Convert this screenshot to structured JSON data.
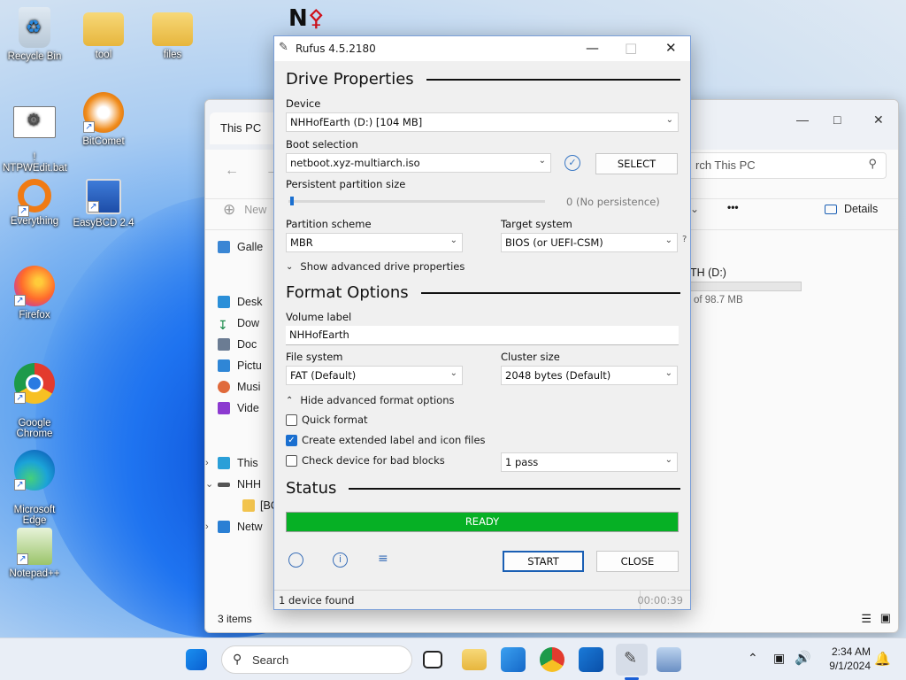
{
  "desktop": {
    "icons": [
      {
        "label": "Recycle Bin"
      },
      {
        "label": "tool"
      },
      {
        "label": "files"
      },
      {
        "label": "!\nNTPWEdit.bat"
      },
      {
        "label": "BitComet"
      },
      {
        "label": "Everything"
      },
      {
        "label": "EasyBCD 2.4"
      },
      {
        "label": "Firefox"
      },
      {
        "label": "Google\nChrome"
      },
      {
        "label": "Microsoft\nEdge"
      },
      {
        "label": "Notepad++"
      }
    ]
  },
  "explorer": {
    "tab": "This PC",
    "search_placeholder": "rch This PC",
    "new_label": "New",
    "details_label": "Details",
    "more": "•••",
    "nav": [
      "Galle",
      "Desk",
      "Dow",
      "Doc",
      "Pictu",
      "Musi",
      "Vide",
      "This",
      "NHH",
      "[BO",
      "Netw"
    ],
    "drive_label": "TH (D:)",
    "drive_free": "of 98.7 MB",
    "status": "3 items"
  },
  "rufus": {
    "title": "Rufus 4.5.2180",
    "drive_properties": "Drive Properties",
    "device_label": "Device",
    "device_value": "NHHofEarth (D:) [104 MB]",
    "boot_label": "Boot selection",
    "boot_value": "netboot.xyz-multiarch.iso",
    "select_button": "SELECT",
    "persistent_label": "Persistent partition size",
    "persistent_value": "0 (No persistence)",
    "partition_label": "Partition scheme",
    "partition_value": "MBR",
    "target_label": "Target system",
    "target_value": "BIOS (or UEFI-CSM)",
    "help_mark": "?",
    "show_advanced": "Show advanced drive properties",
    "format_options": "Format Options",
    "volume_label": "Volume label",
    "volume_value": "NHHofEarth",
    "filesystem_label": "File system",
    "filesystem_value": "FAT (Default)",
    "cluster_label": "Cluster size",
    "cluster_value": "2048 bytes (Default)",
    "hide_advanced": "Hide advanced format options",
    "quick_format": "Quick format",
    "extended_label": "Create extended label and icon files",
    "bad_blocks": "Check device for bad blocks",
    "passes_value": "1 pass",
    "status_title": "Status",
    "progress_text": "READY",
    "progress_color": "#06b025",
    "start_button": "START",
    "close_button": "CLOSE",
    "footer_status": "1 device found",
    "footer_timer": "00:00:39"
  },
  "taskbar": {
    "search_placeholder": "Search",
    "time": "2:34 AM",
    "date": "9/1/2024"
  }
}
